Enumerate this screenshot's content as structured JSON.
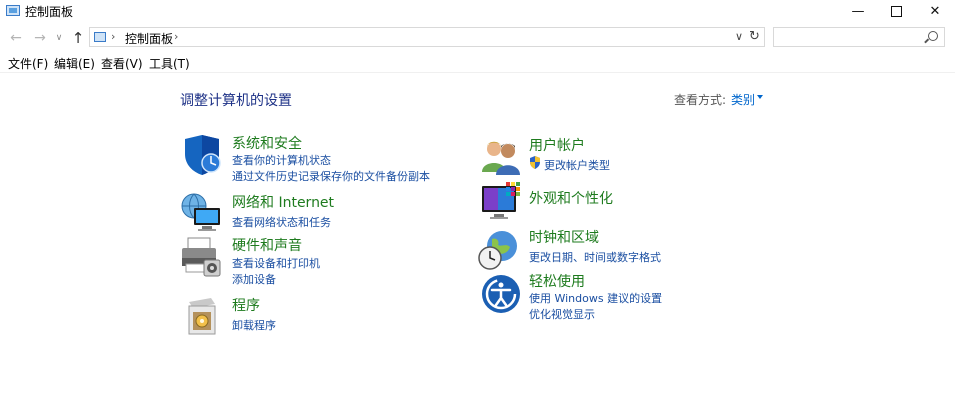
{
  "window": {
    "title": "控制面板",
    "minimize_glyph": "—",
    "close_glyph": "✕"
  },
  "address": {
    "back_glyph": "←",
    "forward_glyph": "→",
    "recent_glyph": "∨",
    "up_glyph": "↑",
    "sep": "›",
    "crumb": "控制面板",
    "dropdown_glyph": "∨",
    "refresh_glyph": "↻",
    "search_value": ""
  },
  "menu": {
    "file": "文件(F)",
    "edit": "编辑(E)",
    "view": "查看(V)",
    "tools": "工具(T)"
  },
  "content": {
    "heading": "调整计算机的设置",
    "view_by_label": "查看方式:",
    "view_by_value": "类别",
    "left": [
      {
        "icon": "security-shield-icon",
        "title": "系统和安全",
        "links": [
          "查看你的计算机状态",
          "通过文件历史记录保存你的文件备份副本"
        ]
      },
      {
        "icon": "network-globe-icon",
        "title": "网络和 Internet",
        "links": [
          "查看网络状态和任务"
        ]
      },
      {
        "icon": "printer-icon",
        "title": "硬件和声音",
        "links": [
          "查看设备和打印机",
          "添加设备"
        ]
      },
      {
        "icon": "programs-box-icon",
        "title": "程序",
        "links": [
          "卸载程序"
        ]
      }
    ],
    "right": [
      {
        "icon": "users-icon",
        "title": "用户帐户",
        "links": [
          "更改帐户类型"
        ]
      },
      {
        "icon": "monitor-palette-icon",
        "title": "外观和个性化",
        "links": []
      },
      {
        "icon": "clock-globe-icon",
        "title": "时钟和区域",
        "links": [
          "更改日期、时间或数字格式"
        ]
      },
      {
        "icon": "accessibility-icon",
        "title": "轻松使用",
        "links": [
          "使用 Windows 建议的设置",
          "优化视觉显示"
        ]
      }
    ]
  },
  "colors": {
    "title_green": "#1e7b1e",
    "link_blue": "#1a4ea1",
    "heading_blue": "#1e3287"
  }
}
